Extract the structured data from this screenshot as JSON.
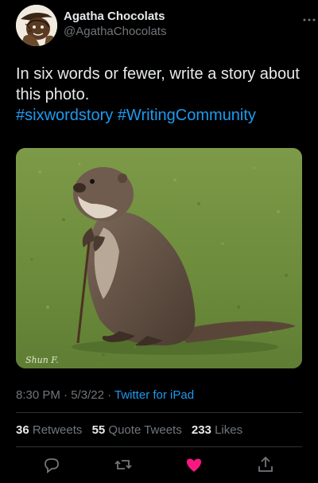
{
  "author": {
    "display_name": "Agatha Chocolats",
    "handle": "@AgathaChocolats",
    "avatar_icon": "sketched-bear-avatar"
  },
  "more_icon": "more-horizontal-icon",
  "tweet": {
    "text": "In six words or fewer, write a story about this photo.",
    "hashtags": "#sixwordstory #WritingCommunity"
  },
  "media": {
    "watermark": "Shun F."
  },
  "meta": {
    "time": "8:30 PM",
    "sep1": "·",
    "date": "5/3/22",
    "sep2": "·",
    "source": "Twitter for iPad"
  },
  "stats": {
    "retweets_count": "36",
    "retweets_label": "Retweets",
    "quotes_count": "55",
    "quotes_label": "Quote Tweets",
    "likes_count": "233",
    "likes_label": "Likes"
  },
  "actions": {
    "reply_icon": "reply-icon",
    "retweet_icon": "retweet-icon",
    "like_icon": "heart-icon",
    "like_color": "#f91880",
    "share_icon": "share-icon"
  },
  "colors": {
    "background": "#000000",
    "text": "#e7e9ea",
    "muted": "#71767b",
    "link": "#1d9bf0",
    "divider": "#2f3336"
  }
}
